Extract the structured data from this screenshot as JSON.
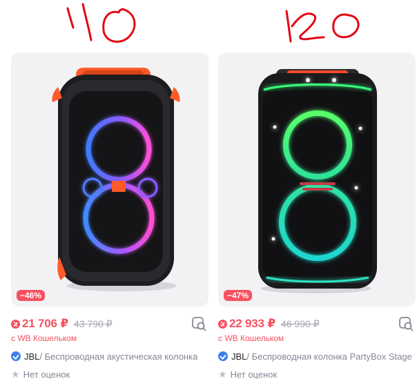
{
  "annotations": {
    "left_note": "110",
    "right_note": "120",
    "color": "#e30613"
  },
  "colors": {
    "accent_red": "#f5515f",
    "verified_blue": "#3c7ff0",
    "muted_text": "#868695",
    "image_background": "#f2f2f4"
  },
  "products": [
    {
      "discount": "−46%",
      "price": "21 706 ₽",
      "old_price": "43 790 ₽",
      "wallet_note": "с WB Кошельком",
      "brand": "JBL",
      "name": " / Беспроводная акустическая колонка",
      "rating": "Нет оценок",
      "icons": [
        "wallet-icon",
        "similar-search-icon",
        "verified-icon",
        "star-icon"
      ]
    },
    {
      "discount": "−47%",
      "price": "22 933 ₽",
      "old_price": "46 990 ₽",
      "wallet_note": "с WB Кошельком",
      "brand": "JBL",
      "name": " / Беспроводная колонка PartyBox Stage",
      "rating": "Нет оценок",
      "icons": [
        "wallet-icon",
        "similar-search-icon",
        "verified-icon",
        "star-icon"
      ]
    }
  ]
}
